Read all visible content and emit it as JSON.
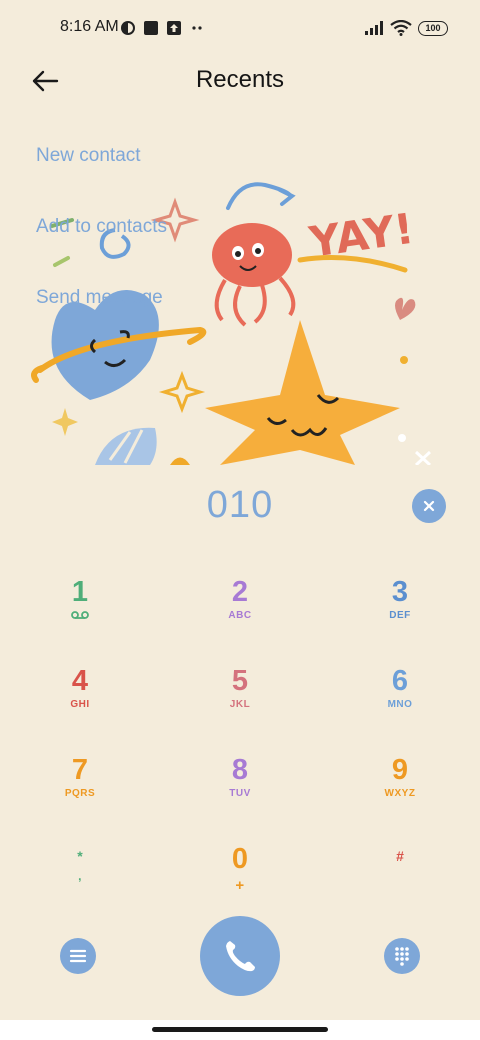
{
  "status_bar": {
    "time": "8:16 AM",
    "battery": "100"
  },
  "header": {
    "title": "Recents"
  },
  "illustration": {
    "yay_text": "YAY!"
  },
  "menu": {
    "items": [
      "New contact",
      "Add to contacts",
      "Send message"
    ]
  },
  "dialer": {
    "number": "010",
    "keys": [
      {
        "digit": "1",
        "letters": "",
        "color": "#4fae79"
      },
      {
        "digit": "2",
        "letters": "ABC",
        "color": "#a77ad4"
      },
      {
        "digit": "3",
        "letters": "DEF",
        "color": "#5b8fcf"
      },
      {
        "digit": "4",
        "letters": "GHI",
        "color": "#d9534a"
      },
      {
        "digit": "5",
        "letters": "JKL",
        "color": "#d4727d"
      },
      {
        "digit": "6",
        "letters": "MNO",
        "color": "#6c9fd8"
      },
      {
        "digit": "7",
        "letters": "PQRS",
        "color": "#ee9922"
      },
      {
        "digit": "8",
        "letters": "TUV",
        "color": "#a77ad4"
      },
      {
        "digit": "9",
        "letters": "WXYZ",
        "color": "#ee9922"
      },
      {
        "digit": "*",
        "letters": ",",
        "color": "#4fae79"
      },
      {
        "digit": "0",
        "letters": "+",
        "color": "#ee9922"
      },
      {
        "digit": "#",
        "letters": "",
        "color": "#d9534a"
      }
    ]
  },
  "colors": {
    "accent": "#7ea7d8",
    "background": "#f4ecdb"
  }
}
